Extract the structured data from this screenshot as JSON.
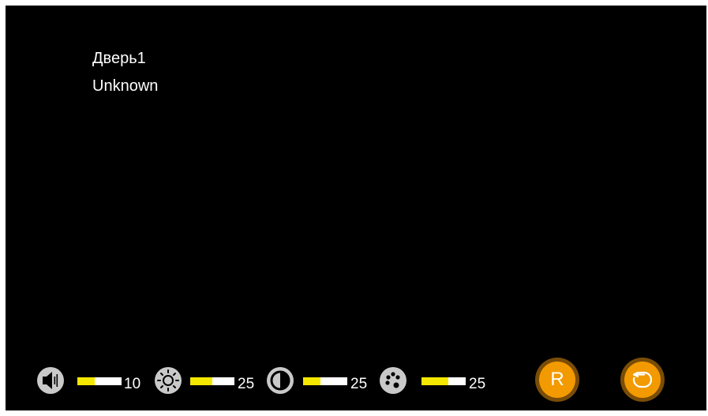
{
  "screen": {
    "door_label": "Дверь1",
    "caller_status": "Unknown"
  },
  "controls": {
    "volume": {
      "icon": "speaker-icon",
      "value": "10",
      "level": 0.4
    },
    "brightness": {
      "icon": "sun-icon",
      "value": "25",
      "level": 0.5
    },
    "contrast": {
      "icon": "contrast-icon",
      "value": "25",
      "level": 0.4
    },
    "color": {
      "icon": "palette-icon",
      "value": "25",
      "level": 0.6
    }
  },
  "buttons": {
    "reset_label": "R",
    "back_icon": "return-icon"
  },
  "colors": {
    "background": "#000000",
    "level_fill": "#f5e800",
    "level_track": "#ffffff",
    "button_face": "#f39a00",
    "button_ring": "#7a4d07",
    "icon_fill": "#c9c9c9"
  }
}
